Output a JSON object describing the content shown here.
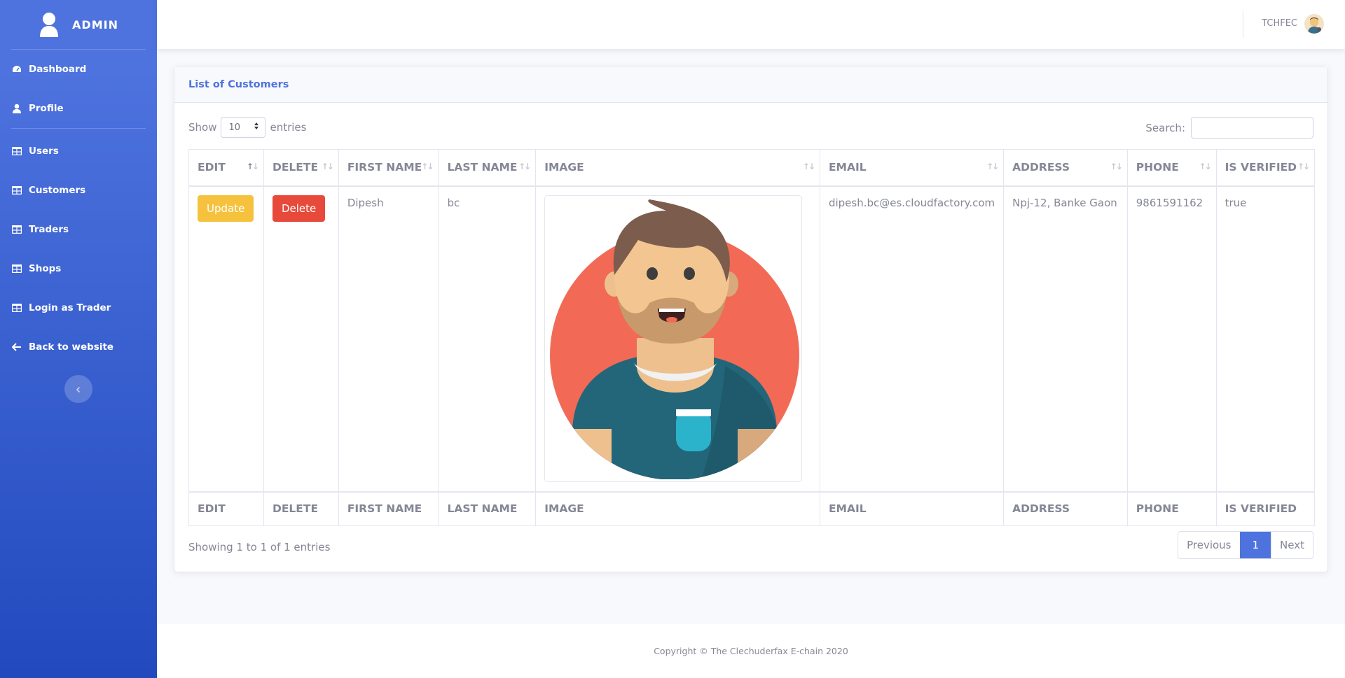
{
  "sidebar": {
    "brand": "ADMIN",
    "items": [
      {
        "label": "Dashboard",
        "icon": "tachometer-icon"
      },
      {
        "label": "Profile",
        "icon": "user-icon"
      },
      {
        "label": "Users",
        "icon": "table-icon"
      },
      {
        "label": "Customers",
        "icon": "table-icon"
      },
      {
        "label": "Traders",
        "icon": "table-icon"
      },
      {
        "label": "Shops",
        "icon": "table-icon"
      },
      {
        "label": "Login as Trader",
        "icon": "table-icon"
      },
      {
        "label": "Back to website",
        "icon": "arrow-left-icon"
      }
    ],
    "toggle_icon": "chevron-left-icon"
  },
  "topbar": {
    "user_name": "TCHFEC"
  },
  "card": {
    "title": "List of Customers",
    "length": {
      "prefix": "Show",
      "value": "10",
      "suffix": "entries"
    },
    "search_label": "Search:",
    "search_value": "",
    "columns": [
      "EDIT",
      "DELETE",
      "FIRST NAME",
      "LAST NAME",
      "IMAGE",
      "EMAIL",
      "ADDRESS",
      "PHONE",
      "IS VERIFIED"
    ],
    "rows": [
      {
        "update_label": "Update",
        "delete_label": "Delete",
        "first_name": "Dipesh",
        "last_name": "bc",
        "email": "dipesh.bc@es.cloudfactory.com",
        "address": "Npj-12, Banke Gaon",
        "phone": "9861591162",
        "is_verified": "true"
      }
    ],
    "info": "Showing 1 to 1 of 1 entries",
    "pagination": {
      "previous": "Previous",
      "current": "1",
      "next": "Next"
    }
  },
  "footer": {
    "copyright": "Copyright © The Clechuderfax E-chain 2020"
  },
  "colors": {
    "primary": "#4e73df",
    "warning": "#f6c23e",
    "danger": "#e74a3b",
    "text": "#858796"
  }
}
